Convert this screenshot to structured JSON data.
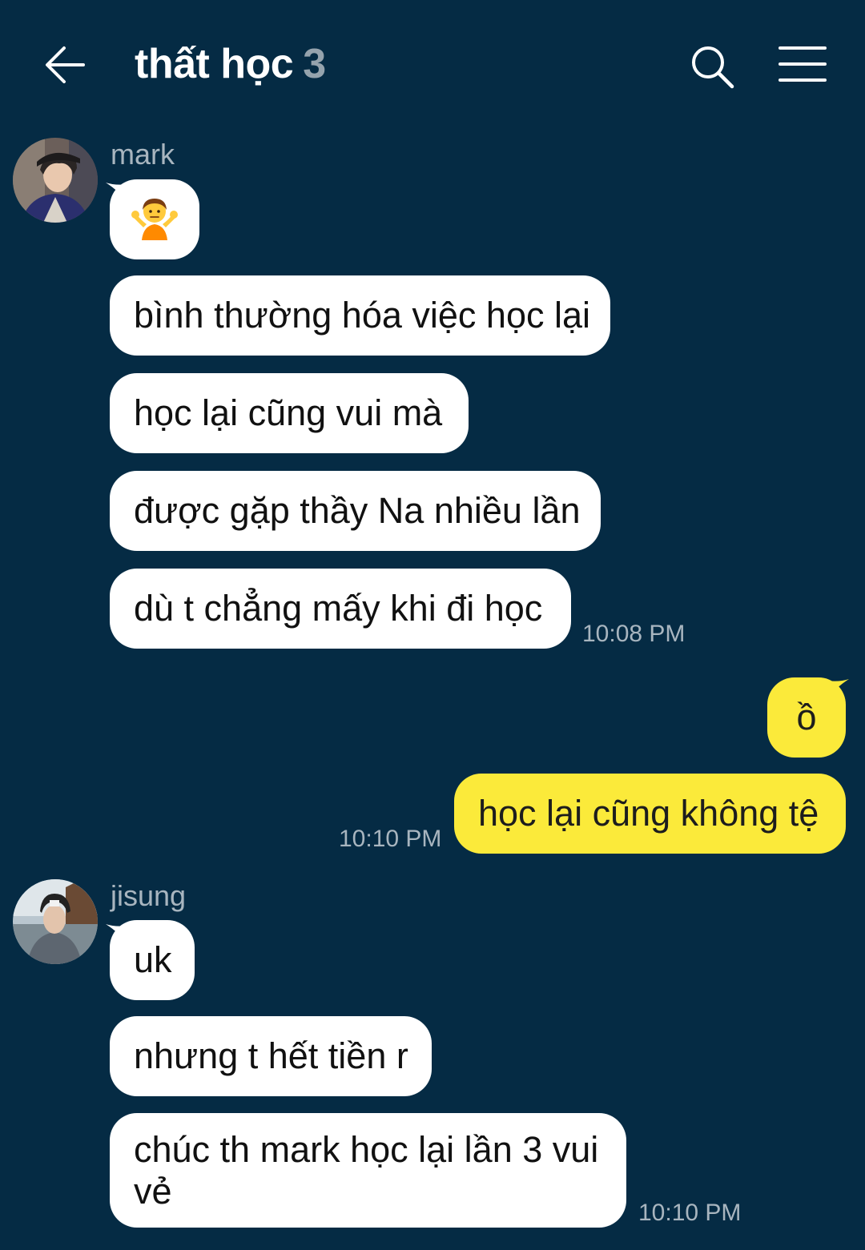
{
  "header": {
    "title": "thất học",
    "member_count": "3",
    "back_icon": "arrow-left-icon",
    "search_icon": "search-icon",
    "menu_icon": "hamburger-menu-icon"
  },
  "colors": {
    "background": "#052b44",
    "incoming_bubble": "#ffffff",
    "outgoing_bubble": "#fbea3a",
    "meta_text": "#a8b5bf"
  },
  "messages": {
    "group1": {
      "sender": "mark",
      "avatar_icon": "user-avatar",
      "items": [
        {
          "type": "emoji",
          "icon": "person-shrugging-emoji"
        },
        {
          "text": "bình thường hóa việc học lại"
        },
        {
          "text": "học lại cũng vui mà"
        },
        {
          "text": "được gặp thầy Na nhiều lần"
        },
        {
          "text": "dù t chẳng mấy khi đi học"
        }
      ],
      "time": "10:08 PM"
    },
    "group2": {
      "sender": "me",
      "items": [
        {
          "text": "ồ"
        },
        {
          "text": "học lại cũng không tệ"
        }
      ],
      "time": "10:10 PM"
    },
    "group3": {
      "sender": "jisung",
      "avatar_icon": "user-avatar",
      "items": [
        {
          "text": "uk"
        },
        {
          "text": "nhưng t hết tiền r"
        },
        {
          "text": "chúc th mark học lại lần 3 vui vẻ"
        }
      ],
      "time": "10:10 PM"
    }
  }
}
